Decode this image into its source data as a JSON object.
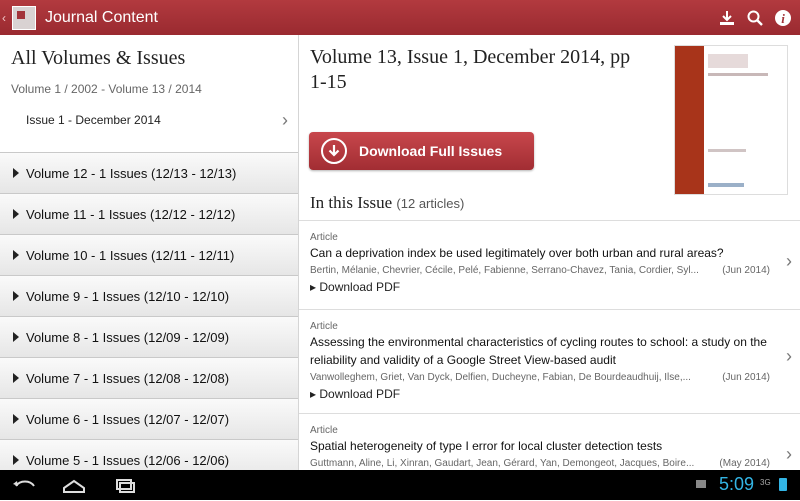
{
  "app": {
    "title": "Journal Content"
  },
  "sidebar": {
    "heading": "All Volumes & Issues",
    "range": "Volume 1 / 2002 - Volume 13 / 2014",
    "current_issue": "Issue 1 - December 2014",
    "volumes": [
      "Volume 12 - 1 Issues (12/13  -  12/13)",
      "Volume 11 - 1 Issues (12/12  -  12/12)",
      "Volume 10 - 1 Issues (12/11  -  12/11)",
      "Volume 9 - 1 Issues (12/10  -  12/10)",
      "Volume 8 - 1 Issues (12/09  -  12/09)",
      "Volume 7 - 1 Issues (12/08  -  12/08)",
      "Volume 6 - 1 Issues (12/07  -  12/07)",
      "Volume 5 - 1 Issues (12/06  -  12/06)"
    ]
  },
  "main": {
    "issue_title": "Volume 13, Issue 1, December 2014, pp 1-15",
    "download_label": "Download Full Issues",
    "in_issue_label": "In this Issue",
    "article_count": "(12 articles)",
    "articles": [
      {
        "type": "Article",
        "title": "Can a deprivation index be used legitimately over both urban and rural areas?",
        "authors": "Bertin, Mélanie, Chevrier, Cécile, Pelé, Fabienne, Serrano-Chavez, Tania, Cordier, Syl...",
        "date": "(Jun 2014)",
        "pdf": "Download PDF"
      },
      {
        "type": "Article",
        "title": "Assessing the environmental characteristics of cycling routes to school: a study on the reliability and validity of a Google Street View-based audit",
        "authors": "Vanwolleghem, Griet, Van Dyck, Delfien, Ducheyne, Fabian, De Bourdeaudhuij, Ilse,...",
        "date": "(Jun 2014)",
        "pdf": "Download PDF"
      },
      {
        "type": "Article",
        "title": "Spatial heterogeneity of type I error for local cluster detection tests",
        "authors": "Guttmann, Aline, Li, Xinran, Gaudart, Jean, Gérard, Yan, Demongeot, Jacques, Boire...",
        "date": "(May 2014)",
        "pdf": ""
      }
    ]
  },
  "status": {
    "clock": "5:09",
    "signal": "3G"
  },
  "colors": {
    "brand": "#a3343a",
    "accent": "#33b5e5"
  }
}
